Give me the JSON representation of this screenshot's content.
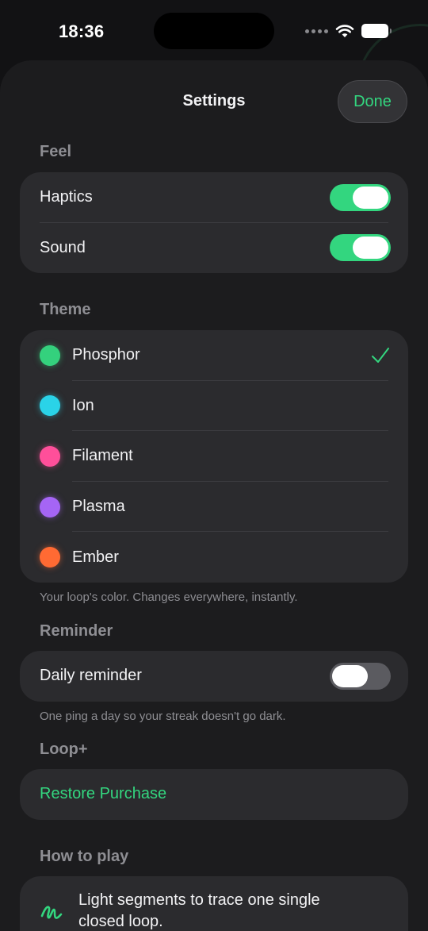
{
  "status_bar": {
    "time": "18:36"
  },
  "sheet": {
    "title": "Settings",
    "done_label": "Done"
  },
  "colors": {
    "accent": "#33d67f",
    "background": "#1c1c1e",
    "card": "#2b2b2e"
  },
  "feel": {
    "header": "Feel",
    "items": [
      {
        "label": "Haptics",
        "on": true
      },
      {
        "label": "Sound",
        "on": true
      }
    ]
  },
  "theme": {
    "header": "Theme",
    "items": [
      {
        "label": "Phosphor",
        "color": "#34d17d",
        "selected": true
      },
      {
        "label": "Ion",
        "color": "#2ad3e8",
        "selected": false
      },
      {
        "label": "Filament",
        "color": "#ff4f9a",
        "selected": false
      },
      {
        "label": "Plasma",
        "color": "#a565f5",
        "selected": false
      },
      {
        "label": "Ember",
        "color": "#ff6a33",
        "selected": false
      }
    ],
    "footnote": "Your loop's color. Changes everywhere, instantly."
  },
  "reminder": {
    "header": "Reminder",
    "label": "Daily reminder",
    "on": false,
    "footnote": "One ping a day so your streak doesn't go dark."
  },
  "loop_plus": {
    "header": "Loop+",
    "restore_label": "Restore Purchase"
  },
  "how_to_play": {
    "header": "How to play",
    "items": [
      {
        "icon": "scribble-icon",
        "text": "Light segments to trace one single closed loop."
      }
    ]
  }
}
